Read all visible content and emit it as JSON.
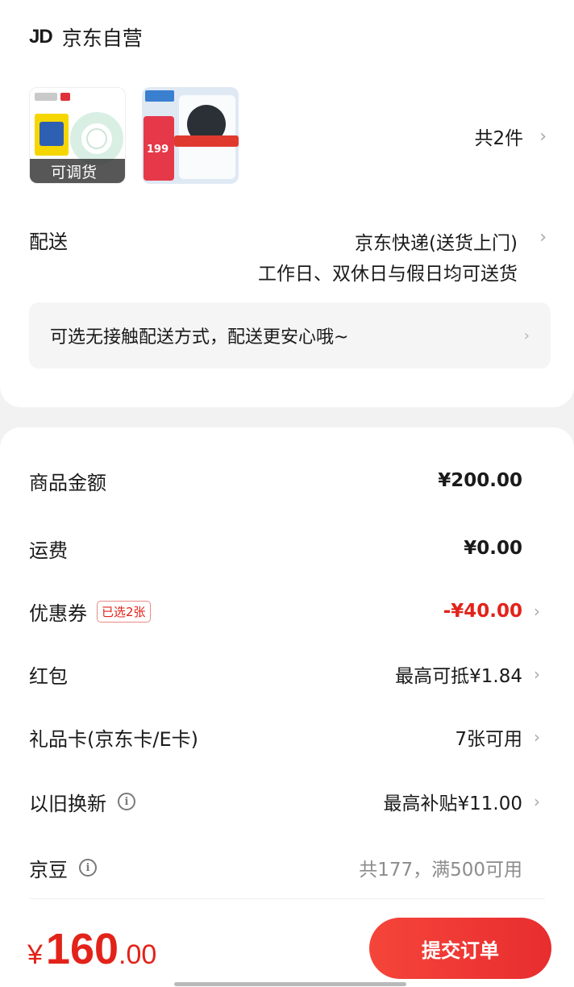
{
  "shop": {
    "logo_text": "JD",
    "name": "京东自营",
    "thumb1_overlay": "可调货",
    "thumb2_price": "199",
    "item_count": "共2件"
  },
  "delivery": {
    "label": "配送",
    "method": "京东快递(送货上门)",
    "schedule": "工作日、双休日与假日均可送货",
    "contactless_text": "可选无接触配送方式，配送更安心哦~"
  },
  "price_rows": [
    {
      "label": "商品金额",
      "value": "¥200.00"
    },
    {
      "label": "运费",
      "value": "¥0.00"
    },
    {
      "label": "优惠券",
      "badge": "已选2张",
      "value": "-¥40.00"
    },
    {
      "label": "红包",
      "value": "最高可抵¥1.84"
    },
    {
      "label": "礼品卡(京东卡/E卡)",
      "value": "7张可用"
    },
    {
      "label": "以旧换新",
      "value": "最高补贴¥11.00"
    },
    {
      "label": "京豆",
      "value": "共177，满500可用"
    }
  ],
  "footer": {
    "currency": "¥",
    "total_int": "160",
    "total_dec": ".00",
    "submit_label": "提交订单"
  },
  "colors": {
    "accent_red": "#e2231a",
    "background": "#f2f2f2"
  },
  "icons": [
    "chevron-right-icon",
    "info-icon",
    "jd-logo"
  ]
}
